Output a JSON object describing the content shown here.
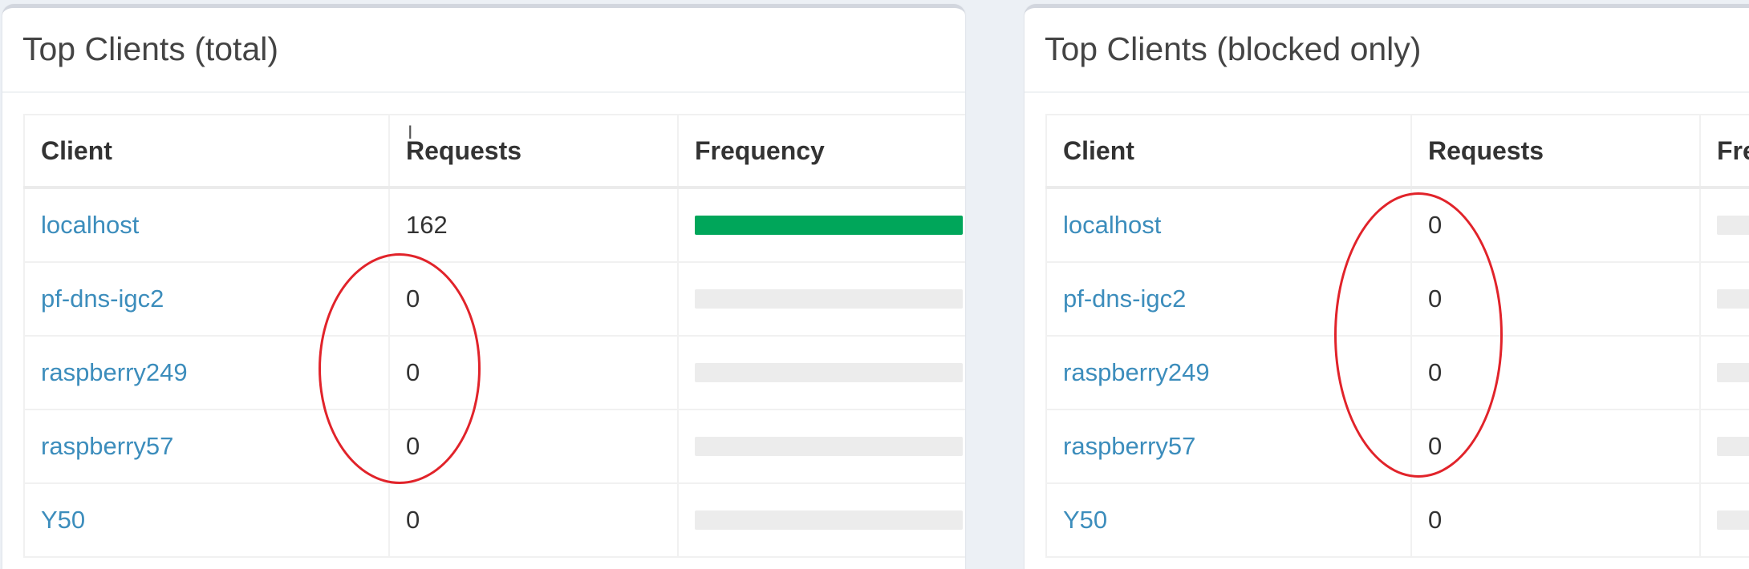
{
  "panels": [
    {
      "title": "Top Clients (total)",
      "columns": [
        "Client",
        "Requests",
        "Frequency"
      ],
      "rows": [
        {
          "client": "localhost",
          "requests": "162",
          "frequency": 1.0
        },
        {
          "client": "pf-dns-igc2",
          "requests": "0",
          "frequency": 0
        },
        {
          "client": "raspberry249",
          "requests": "0",
          "frequency": 0
        },
        {
          "client": "raspberry57",
          "requests": "0",
          "frequency": 0
        },
        {
          "client": "Y50",
          "requests": "0",
          "frequency": 0
        }
      ]
    },
    {
      "title": "Top Clients (blocked only)",
      "columns": [
        "Client",
        "Requests",
        "Frequency"
      ],
      "rows": [
        {
          "client": "localhost",
          "requests": "0",
          "frequency": 0
        },
        {
          "client": "pf-dns-igc2",
          "requests": "0",
          "frequency": 0
        },
        {
          "client": "raspberry249",
          "requests": "0",
          "frequency": 0
        },
        {
          "client": "raspberry57",
          "requests": "0",
          "frequency": 0
        },
        {
          "client": "Y50",
          "requests": "0",
          "frequency": 0
        }
      ]
    }
  ],
  "colors": {
    "link": "#3c8dbc",
    "bar_fill": "#00a65a",
    "bar_track": "#ececec",
    "annotation": "#e1232a",
    "page_background": "#ecf0f5"
  },
  "icons": {
    "cursor": "text-cursor-icon"
  }
}
